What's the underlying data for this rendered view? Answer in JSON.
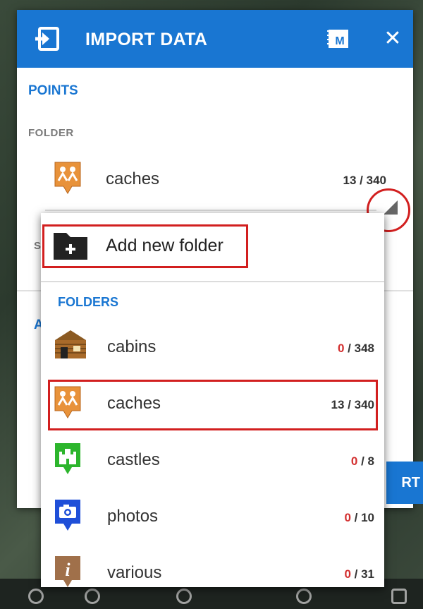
{
  "header": {
    "title": "IMPORT DATA",
    "close_glyph": "✕",
    "locus_badge": "M"
  },
  "points": {
    "section_title": "POINTS",
    "folder_label": "FOLDER",
    "selected_folder": {
      "name": "caches",
      "count": "13 / 340",
      "icon": "cache-marker-icon"
    },
    "hidden_label_s": "S",
    "hidden_label_a": "A"
  },
  "import_button_label": "RT",
  "dropdown": {
    "add_new_label": "Add new folder",
    "section_title": "FOLDERS",
    "folders": [
      {
        "name": "cabins",
        "used": "0",
        "total": " / 348",
        "icon": "cabin-icon",
        "highlight_used": true
      },
      {
        "name": "caches",
        "used": "13",
        "total": " / 340",
        "icon": "cache-marker-icon",
        "highlight_used": false
      },
      {
        "name": "castles",
        "used": "0",
        "total": " / 8",
        "icon": "castle-marker-icon",
        "highlight_used": true
      },
      {
        "name": "photos",
        "used": "0",
        "total": " / 10",
        "icon": "photo-marker-icon",
        "highlight_used": true
      },
      {
        "name": "various",
        "used": "0",
        "total": " / 31",
        "icon": "info-marker-icon",
        "highlight_used": true
      }
    ]
  },
  "colors": {
    "accent": "#1976d2",
    "annotation_red": "#d21f1f",
    "count_red": "#d32f2f",
    "cache_orange": "#e8923a",
    "castle_green": "#2cb52c",
    "photo_blue": "#1f4fd8",
    "various_brown": "#a0704a"
  }
}
